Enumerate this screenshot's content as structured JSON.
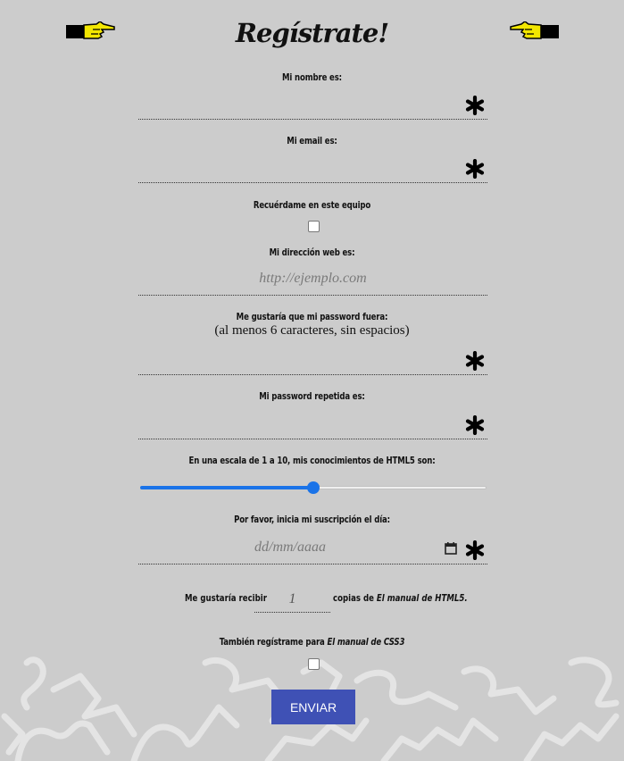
{
  "header": {
    "title": "Regístrate!",
    "left_icon": "pointing-hand-right-icon",
    "right_icon": "pointing-hand-left-icon"
  },
  "form": {
    "name_label": "Mi nombre es:",
    "email_label": "Mi email es:",
    "remember_label": "Recuérdame en este equipo",
    "web_label": "Mi dirección web es:",
    "web_placeholder": "http://ejemplo.com",
    "password_label": "Me gustaría que mi password fuera:",
    "password_hint": "(al menos 6 caracteres, sin espacios)",
    "password_repeat_label": "Mi password repetida es:",
    "html5_label": "En una escala de 1 a 10, mis conocimientos de HTML5 son:",
    "html5_slider_fraction": 0.5,
    "start_date_label": "Por favor, inicia mi suscripción el día:",
    "start_date_placeholder": "dd/mm/aaaa",
    "copies_prefix": "Me gustaría recibir",
    "copies_value": "1",
    "copies_suffix": "copias de",
    "copies_book": "El manual de HTML5.",
    "css3_prefix": "También regístrame para",
    "css3_book": "El manual de CSS3",
    "submit_label": "ENVIAR",
    "required_icon": "asterisk-icon"
  },
  "colors": {
    "background": "#cccccc",
    "submit_bg": "#3f51b5",
    "slider_accent": "#1a73e8"
  }
}
